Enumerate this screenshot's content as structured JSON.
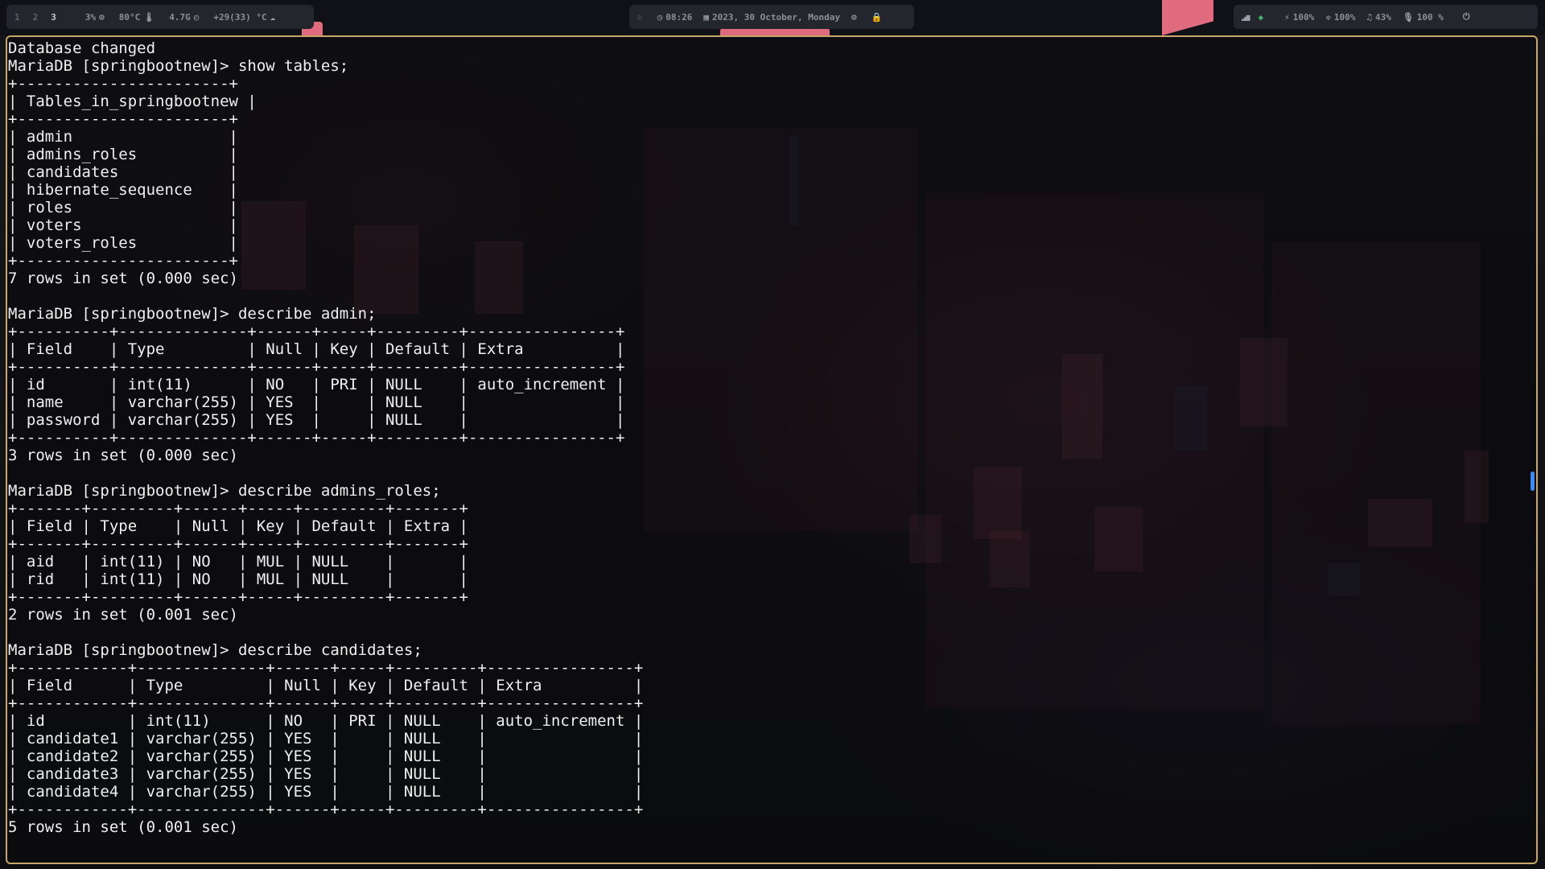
{
  "topbar": {
    "workspaces": [
      "1",
      "2",
      "3"
    ],
    "active_workspace": "3",
    "left_stats": [
      {
        "icon": "cpu-icon",
        "glyph": "⊙",
        "value": "3%"
      },
      {
        "icon": "thermometer-icon",
        "glyph": "🌡",
        "value": "80°C"
      },
      {
        "icon": "memory-icon",
        "glyph": "◴",
        "value": "4.7G"
      },
      {
        "icon": "weather-icon",
        "glyph": "☁",
        "value": "+29(33) °C"
      }
    ],
    "center": {
      "alert_glyph": "♘",
      "time": "08:26",
      "date": "2023, 30 October, Monday",
      "record_glyph": "⊙",
      "lock_glyph": "🔒"
    },
    "right_stats": [
      {
        "icon": "signal-icon",
        "glyph": "▂▄▆",
        "value": ""
      },
      {
        "icon": "app-icon",
        "glyph": "◆",
        "value": ""
      },
      {
        "icon": "battery-icon",
        "glyph": "⚡",
        "value": "100%"
      },
      {
        "icon": "brightness-icon",
        "glyph": "✲",
        "value": "100%"
      },
      {
        "icon": "bluetooth-headphones-icon",
        "glyph": "♫",
        "value": "43%"
      },
      {
        "icon": "microphone-icon",
        "glyph": "🎙",
        "value": "100 %"
      },
      {
        "icon": "power-icon",
        "glyph": "⏻",
        "value": ""
      }
    ],
    "colors": {
      "accent": "#e06a7e",
      "pill_bg": "#24262d",
      "text": "#8b8f98"
    }
  },
  "terminal": {
    "border_color": "#c9a669",
    "text_color": "#f0f0f0",
    "lines": [
      "Database changed",
      "MariaDB [springbootnew]> show tables;",
      "+-----------------------+",
      "| Tables_in_springbootnew |",
      "+-----------------------+",
      "| admin                 |",
      "| admins_roles          |",
      "| candidates            |",
      "| hibernate_sequence    |",
      "| roles                 |",
      "| voters                |",
      "| voters_roles          |",
      "+-----------------------+",
      "7 rows in set (0.000 sec)",
      "",
      "MariaDB [springbootnew]> describe admin;",
      "+----------+--------------+------+-----+---------+----------------+",
      "| Field    | Type         | Null | Key | Default | Extra          |",
      "+----------+--------------+------+-----+---------+----------------+",
      "| id       | int(11)      | NO   | PRI | NULL    | auto_increment |",
      "| name     | varchar(255) | YES  |     | NULL    |                |",
      "| password | varchar(255) | YES  |     | NULL    |                |",
      "+----------+--------------+------+-----+---------+----------------+",
      "3 rows in set (0.000 sec)",
      "",
      "MariaDB [springbootnew]> describe admins_roles;",
      "+-------+---------+------+-----+---------+-------+",
      "| Field | Type    | Null | Key | Default | Extra |",
      "+-------+---------+------+-----+---------+-------+",
      "| aid   | int(11) | NO   | MUL | NULL    |       |",
      "| rid   | int(11) | NO   | MUL | NULL    |       |",
      "+-------+---------+------+-----+---------+-------+",
      "2 rows in set (0.001 sec)",
      "",
      "MariaDB [springbootnew]> describe candidates;",
      "+------------+--------------+------+-----+---------+----------------+",
      "| Field      | Type         | Null | Key | Default | Extra          |",
      "+------------+--------------+------+-----+---------+----------------+",
      "| id         | int(11)      | NO   | PRI | NULL    | auto_increment |",
      "| candidate1 | varchar(255) | YES  |     | NULL    |                |",
      "| candidate2 | varchar(255) | YES  |     | NULL    |                |",
      "| candidate3 | varchar(255) | YES  |     | NULL    |                |",
      "| candidate4 | varchar(255) | YES  |     | NULL    |                |",
      "+------------+--------------+------+-----+---------+----------------+",
      "5 rows in set (0.001 sec)"
    ]
  }
}
